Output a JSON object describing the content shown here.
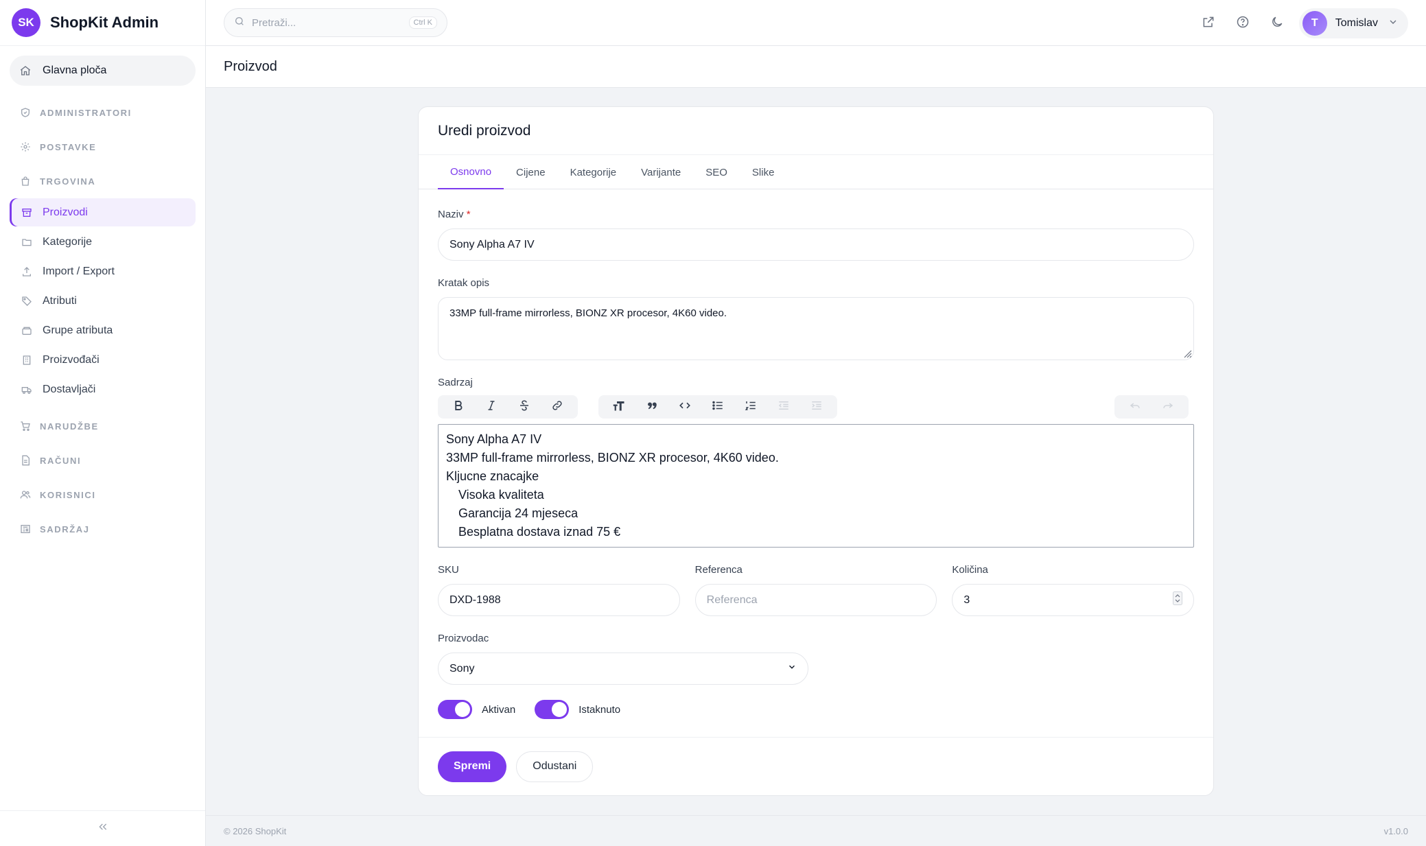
{
  "brand": {
    "logo_text": "SK",
    "name": "ShopKit Admin",
    "accent": "#7c3aed"
  },
  "sidebar": {
    "dashboard": "Glavna ploča",
    "groups": {
      "administrators": "ADMINISTRATORI",
      "settings": "POSTAVKE",
      "shop": "TRGOVINA",
      "orders": "NARUDŽBE",
      "invoices": "RAČUNI",
      "users": "KORISNICI",
      "content": "SADRŽAJ"
    },
    "shop_items": [
      {
        "label": "Proizvodi",
        "icon": "box-icon",
        "active": true
      },
      {
        "label": "Kategorije",
        "icon": "folder-icon"
      },
      {
        "label": "Import / Export",
        "icon": "upload-icon"
      },
      {
        "label": "Atributi",
        "icon": "tag-icon"
      },
      {
        "label": "Grupe atributa",
        "icon": "layers-icon"
      },
      {
        "label": "Proizvođači",
        "icon": "building-icon"
      },
      {
        "label": "Dostavljači",
        "icon": "truck-icon"
      }
    ],
    "collapse_icon": "chevrons-left-icon"
  },
  "topbar": {
    "search_placeholder": "Pretraži...",
    "search_shortcut": "Ctrl K",
    "user_initial": "T",
    "user_name": "Tomislav"
  },
  "page": {
    "title": "Proizvod"
  },
  "card": {
    "title": "Uredi proizvod",
    "tabs": [
      "Osnovno",
      "Cijene",
      "Kategorije",
      "Varijante",
      "SEO",
      "Slike"
    ],
    "active_tab": "Osnovno"
  },
  "form": {
    "name_label": "Naziv",
    "name_required": "*",
    "name_value": "Sony Alpha A7 IV",
    "short_desc_label": "Kratak opis",
    "short_desc_value": "33MP full-frame mirrorless, BIONZ XR procesor, 4K60 video.",
    "content_label": "Sadrzaj",
    "content_lines": [
      "Sony Alpha A7 IV",
      "33MP full-frame mirrorless, BIONZ XR procesor, 4K60 video.",
      "Kljucne znacajke"
    ],
    "content_bullets": [
      "Visoka kvaliteta",
      "Garancija 24 mjeseca",
      "Besplatna dostava iznad 75 €"
    ],
    "sku_label": "SKU",
    "sku_value": "DXD-1988",
    "reference_label": "Referenca",
    "reference_placeholder": "Referenca",
    "quantity_label": "Količina",
    "quantity_value": "3",
    "manufacturer_label": "Proizvodac",
    "manufacturer_value": "Sony",
    "toggle_active_label": "Aktivan",
    "toggle_active_on": true,
    "toggle_featured_label": "Istaknuto",
    "toggle_featured_on": true,
    "save_label": "Spremi",
    "cancel_label": "Odustani"
  },
  "footer": {
    "copyright": "© 2026 ShopKit",
    "version": "v1.0.0"
  }
}
